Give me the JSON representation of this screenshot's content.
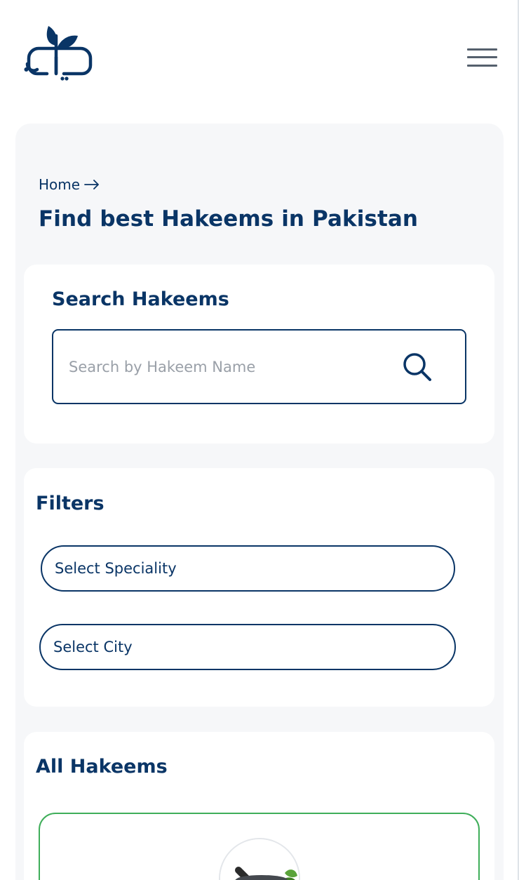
{
  "header": {
    "logo_icon": "pharmacy-leaf-capsule-logo",
    "menu_icon": "hamburger-menu-icon"
  },
  "breadcrumb": {
    "home_label": "Home",
    "separator_icon": "arrow-right-icon"
  },
  "page_title": {
    "prefix": "Find best ",
    "highlight": "Hakeems",
    "suffix": " in Pakistan"
  },
  "search": {
    "title": "Search Hakeems",
    "placeholder": "Search by Hakeem Name",
    "value": "",
    "icon": "search-icon"
  },
  "filters": {
    "title": "Filters",
    "speciality_label": "Select Speciality",
    "city_label": "Select City"
  },
  "all_hakeems": {
    "title": "All Hakeems",
    "card_image_icon": "mortar-pestle-herbs-image"
  },
  "colors": {
    "primary": "#0a3566",
    "panel_bg": "#f6f7f9",
    "card_border_green": "#3fae5a",
    "placeholder": "#9aa0a8"
  }
}
